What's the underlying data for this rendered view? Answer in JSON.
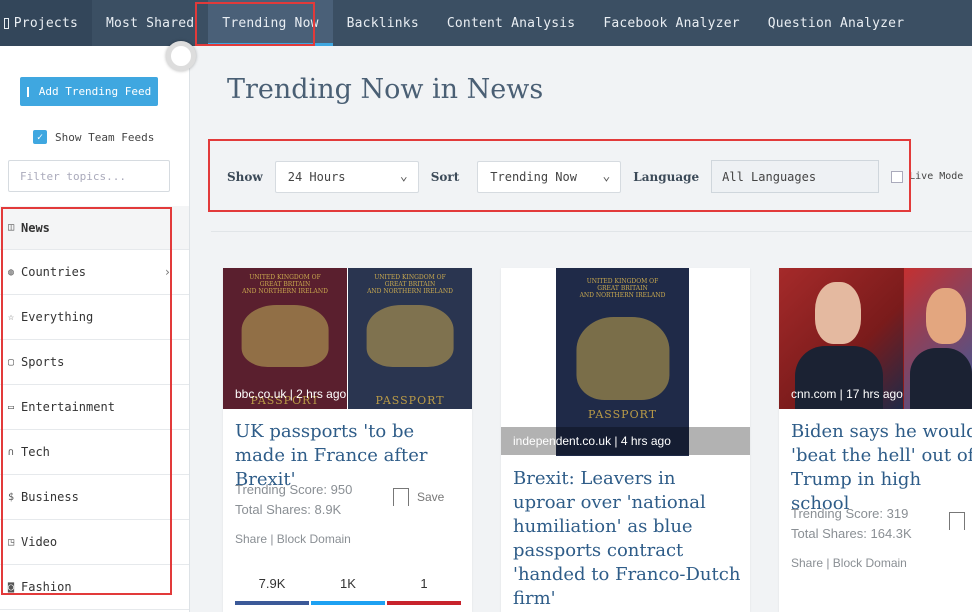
{
  "nav": {
    "projects": "Projects",
    "items": [
      "Most Shared",
      "Trending Now",
      "Backlinks",
      "Content Analysis",
      "Facebook Analyzer",
      "Question Analyzer"
    ],
    "active": "Trending Now"
  },
  "sidebar": {
    "add_button": "Add Trending Feed",
    "show_team_feeds": "Show Team Feeds",
    "filter_placeholder": "Filter topics...",
    "topics": [
      {
        "label": "News",
        "icon": "book-icon"
      },
      {
        "label": "Countries",
        "icon": "globe-icon"
      },
      {
        "label": "Everything",
        "icon": "star-icon"
      },
      {
        "label": "Sports",
        "icon": "ball-icon"
      },
      {
        "label": "Entertainment",
        "icon": "tv-icon"
      },
      {
        "label": "Tech",
        "icon": "headphones-icon"
      },
      {
        "label": "Business",
        "icon": "dollar-icon"
      },
      {
        "label": "Video",
        "icon": "video-icon"
      },
      {
        "label": "Fashion",
        "icon": "camera-icon"
      }
    ]
  },
  "main": {
    "title": "Trending Now in News",
    "controls": {
      "show_label": "Show",
      "show_value": "24 Hours",
      "sort_label": "Sort",
      "sort_value": "Trending Now",
      "language_label": "Language",
      "language_value": "All Languages",
      "live_mode": "Live Mode"
    },
    "cards": [
      {
        "source": "bbc.co.uk | 2 hrs ago",
        "title": "UK passports 'to be made in France after Brexit'",
        "trending_score": "Trending Score: 950",
        "total_shares": "Total Shares: 8.9K",
        "save": "Save",
        "links": "Share | Block Domain",
        "stats": [
          "7.9K",
          "1K",
          "1"
        ]
      },
      {
        "source": "independent.co.uk | 4 hrs ago",
        "title": "Brexit: Leavers in uproar over 'national humiliation' as blue passports contract 'handed to Franco-Dutch firm'"
      },
      {
        "source": "cnn.com | 17 hrs ago",
        "title": "Biden says he would 'beat the hell' out of Trump in high school",
        "trending_score": "Trending Score: 319",
        "total_shares": "Total Shares: 164.3K",
        "links": "Share | Block Domain"
      }
    ]
  },
  "colors": {
    "nav_bg": "#3b4f63",
    "accent": "#3fa7e0",
    "title_link": "#2e5c88",
    "facebook": "#3b5998",
    "twitter": "#1da1f2",
    "pinterest": "#c8232c",
    "highlight": "#e23a3a"
  }
}
